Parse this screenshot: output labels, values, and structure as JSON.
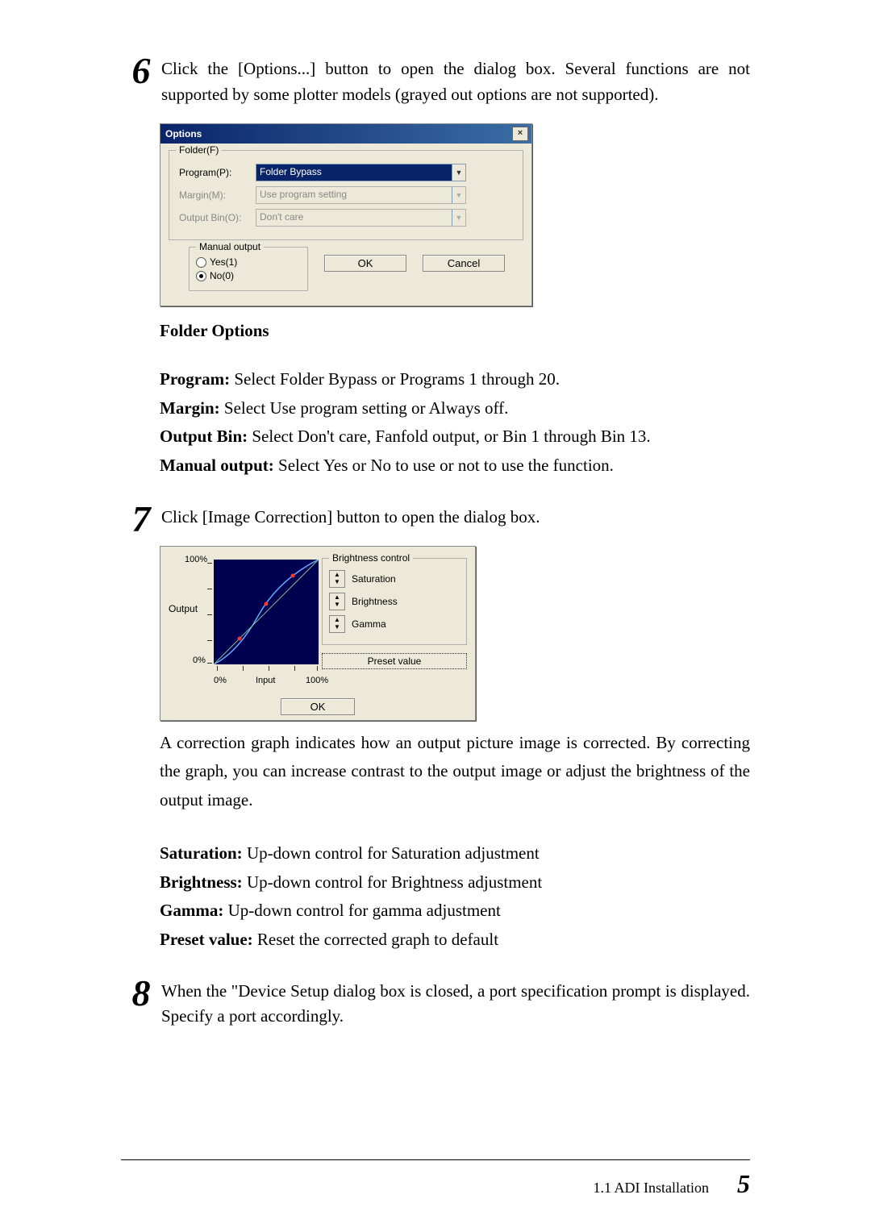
{
  "step6": {
    "num": "6",
    "text": "Click the [Options...] button to open the dialog box. Several functions are not supported by some plotter models (grayed out options are not supported)."
  },
  "optionsDialog": {
    "title": "Options",
    "close": "×",
    "folderLegend": "Folder(F)",
    "rows": {
      "program": {
        "label": "Program(P):",
        "value": "Folder Bypass"
      },
      "margin": {
        "label": "Margin(M):",
        "value": "Use program setting"
      },
      "output": {
        "label": "Output Bin(O):",
        "value": "Don't care"
      }
    },
    "manualLegend": "Manual output",
    "radioYes": "Yes(1)",
    "radioNo": "No(0)",
    "ok": "OK",
    "cancel": "Cancel"
  },
  "folderOptionsTitle": "Folder Options",
  "folderOptions": {
    "programLabel": "Program:",
    "programText": " Select Folder Bypass or Programs 1 through 20.",
    "marginLabel": "Margin:",
    "marginText": " Select Use program setting or Always off.",
    "outputLabel": "Output Bin:",
    "outputText": " Select Don't care, Fanfold output, or Bin 1 through Bin 13.",
    "manualLabel": "Manual output:",
    "manualText": " Select Yes or No to use or not to use the function."
  },
  "step7": {
    "num": "7",
    "text": "Click [Image Correction] button to open the dialog box."
  },
  "icDialog": {
    "y100": "100%",
    "y0": "0%",
    "x0": "0%",
    "xInput": "Input",
    "x100": "100%",
    "ylabel": "Output",
    "brightnessLegend": "Brightness control",
    "saturation": "Saturation",
    "brightness": "Brightness",
    "gamma": "Gamma",
    "preset": "Preset value",
    "ok": "OK"
  },
  "step7_para": "A correction graph indicates how an output picture image is corrected. By correcting the graph, you can increase contrast to the output image or adjust the brightness of the output image.",
  "corrections": {
    "saturationLabel": "Saturation:",
    "saturationText": " Up-down control for Saturation adjustment",
    "brightnessLabel": "Brightness:",
    "brightnessText": " Up-down control for Brightness adjustment",
    "gammaLabel": "Gamma:",
    "gammaText": " Up-down control for gamma adjustment",
    "presetLabel": "Preset value:",
    "presetText": " Reset the corrected graph to default"
  },
  "step8": {
    "num": "8",
    "text": "When the \"Device Setup dialog box is closed, a port specification prompt is displayed. Specify a port accordingly."
  },
  "footer": {
    "section": "1.1  ADI Installation",
    "page": "5"
  }
}
